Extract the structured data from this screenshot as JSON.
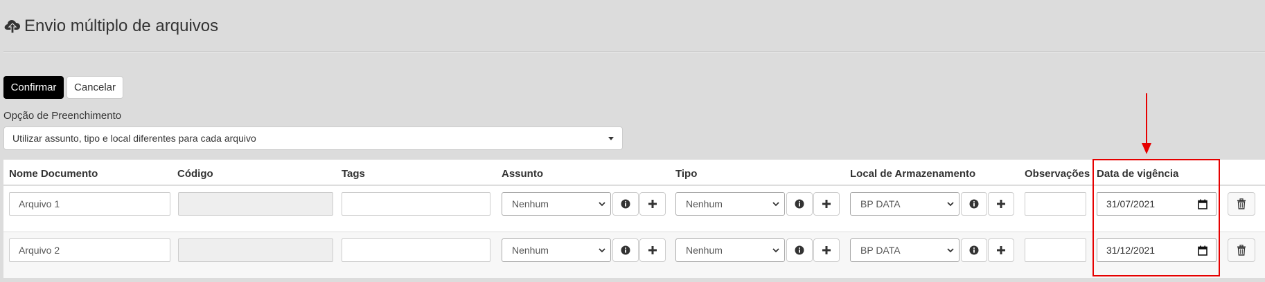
{
  "header": {
    "title": "Envio múltiplo de arquivos",
    "icon": "cloud-upload-icon"
  },
  "actions": {
    "confirm_label": "Confirmar",
    "cancel_label": "Cancelar"
  },
  "fill_option": {
    "label": "Opção de Preenchimento",
    "selected": "Utilizar assunto, tipo e local diferentes para cada arquivo"
  },
  "table": {
    "columns": [
      "Nome Documento",
      "Código",
      "Tags",
      "Assunto",
      "Tipo",
      "Local de Armazenamento",
      "Observações",
      "Data de vigência"
    ],
    "rows": [
      {
        "nome": "Arquivo 1",
        "codigo": "",
        "tags": "",
        "assunto": "Nenhum",
        "tipo": "Nenhum",
        "local": "BP DATA",
        "observacoes": "",
        "data": "31/07/2021"
      },
      {
        "nome": "Arquivo 2",
        "codigo": "",
        "tags": "",
        "assunto": "Nenhum",
        "tipo": "Nenhum",
        "local": "BP DATA",
        "observacoes": "",
        "data": "31/12/2021"
      }
    ]
  },
  "annotation": {
    "color": "#e60000"
  }
}
